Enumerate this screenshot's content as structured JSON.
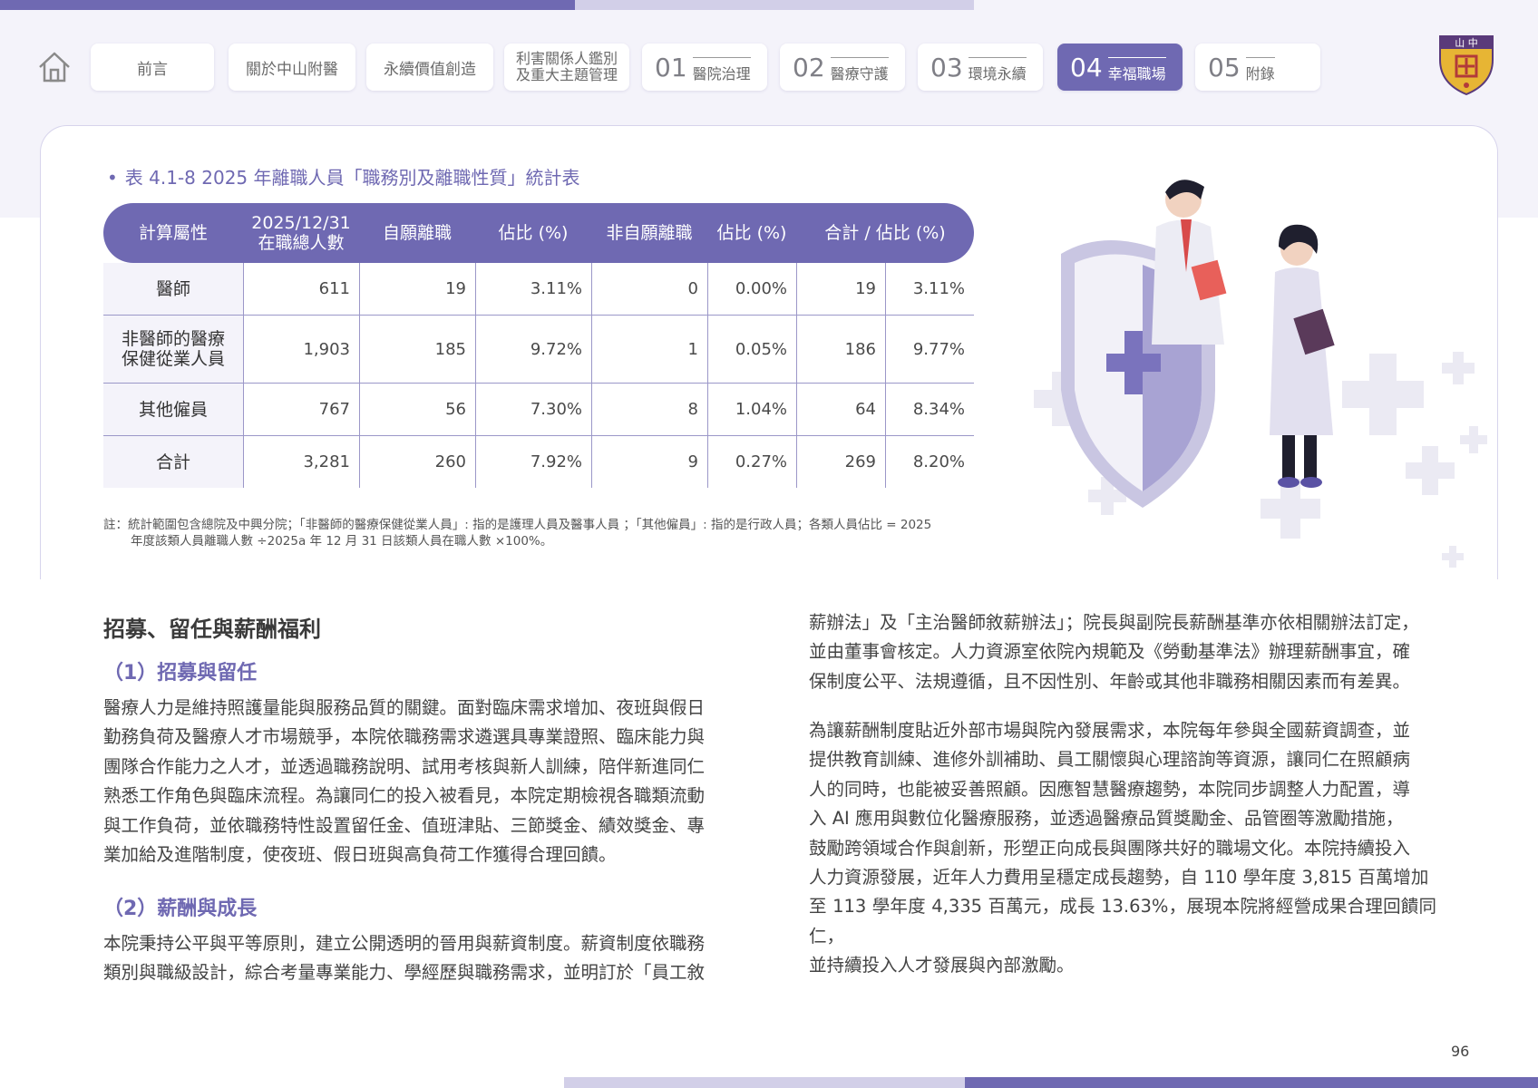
{
  "nav": {
    "tabs": [
      {
        "label": "前言"
      },
      {
        "label": "關於中山附醫"
      },
      {
        "label": "永續價值創造"
      },
      {
        "label": "利害關係人鑑別及重大主題管理",
        "line1": "利害關係人鑑別",
        "line2": "及重大主題管理"
      },
      {
        "num": "01",
        "label": "醫院治理"
      },
      {
        "num": "02",
        "label": "醫療守護"
      },
      {
        "num": "03",
        "label": "環境永續"
      },
      {
        "num": "04",
        "label": "幸福職場",
        "active": true
      },
      {
        "num": "05",
        "label": "附錄"
      }
    ],
    "logo_text": "山 中"
  },
  "table": {
    "caption": "表 4.1-8 2025 年離職人員「職務別及離職性質」統計表",
    "headers": [
      "計算屬性",
      "2025/12/31",
      "在職總人數",
      "自願離職",
      "佔比 (%)",
      "非自願離職",
      "佔比 (%)",
      "合計 / 佔比 (%)"
    ],
    "rows": [
      {
        "label": "醫師",
        "cells": [
          "611",
          "19",
          "3.11%",
          "0",
          "0.00%",
          "19",
          "3.11%"
        ]
      },
      {
        "label1": "非醫師的醫療",
        "label2": "保健從業人員",
        "cells": [
          "1,903",
          "185",
          "9.72%",
          "1",
          "0.05%",
          "186",
          "9.77%"
        ]
      },
      {
        "label": "其他僱員",
        "cells": [
          "767",
          "56",
          "7.30%",
          "8",
          "1.04%",
          "64",
          "8.34%"
        ]
      },
      {
        "label": "合計",
        "cells": [
          "3,281",
          "260",
          "7.92%",
          "9",
          "0.27%",
          "269",
          "8.20%"
        ]
      }
    ],
    "note_line1": "註：統計範圍包含總院及中興分院；「非醫師的醫療保健從業人員」: 指的是護理人員及醫事人員 ；「其他僱員」: 指的是行政人員；各類人員佔比 = 2025",
    "note_line2": "年度該類人員離職人數 ÷2025a 年 12 月 31 日該類人員在職人數 ×100%。"
  },
  "article": {
    "section_title": "招募、留任與薪酬福利",
    "sub1_title": "（1）招募與留任",
    "sub1_lines": [
      "醫療人力是維持照護量能與服務品質的關鍵。面對臨床需求增加、夜班與假日",
      "勤務負荷及醫療人才市場競爭，本院依職務需求遴選具專業證照、臨床能力與",
      "團隊合作能力之人才，並透過職務說明、試用考核與新人訓練，陪伴新進同仁",
      "熟悉工作角色與臨床流程。為讓同仁的投入被看見，本院定期檢視各職類流動",
      "與工作負荷，並依職務特性設置留任金、值班津貼、三節獎金、績效獎金、專",
      "業加給及進階制度，使夜班、假日班與高負荷工作獲得合理回饋。"
    ],
    "sub2_title": "（2）薪酬與成長",
    "sub2_lines": [
      "本院秉持公平與平等原則，建立公開透明的晉用與薪資制度。薪資制度依職務",
      "類別與職級設計，綜合考量專業能力、學經歷與職務需求，並明訂於「員工敘"
    ],
    "right1_lines": [
      "薪辦法」及「主治醫師敘薪辦法」；院長與副院長薪酬基準亦依相關辦法訂定，",
      "並由董事會核定。人力資源室依院內規範及《勞動基準法》辦理薪酬事宜，確",
      "保制度公平、法規遵循，且不因性別、年齡或其他非職務相關因素而有差異。"
    ],
    "right2_lines": [
      "為讓薪酬制度貼近外部市場與院內發展需求，本院每年參與全國薪資調查，並",
      "提供教育訓練、進修外訓補助、員工關懷與心理諮詢等資源，讓同仁在照顧病",
      "人的同時，也能被妥善照顧。因應智慧醫療趨勢，本院同步調整人力配置，導",
      "入 AI 應用與數位化醫療服務，並透過醫療品質獎勵金、品管圈等激勵措施，",
      "鼓勵跨領域合作與創新，形塑正向成長與團隊共好的職場文化。本院持續投入",
      "人力資源發展，近年人力費用呈穩定成長趨勢，自 110 學年度 3,815 百萬增加",
      "至 113 學年度 4,335 百萬元，成長 13.63%，展現本院將經營成果合理回饋同仁，",
      "並持續投入人才發展與內部激勵。"
    ]
  },
  "page_number": "96",
  "colors": {
    "accent": "#6f69b2",
    "accent_light": "#d2cfe8",
    "band": "#f4f3fa"
  },
  "icons": [
    "home-icon",
    "hospital-logo-icon",
    "doctors-shield-illustration"
  ]
}
